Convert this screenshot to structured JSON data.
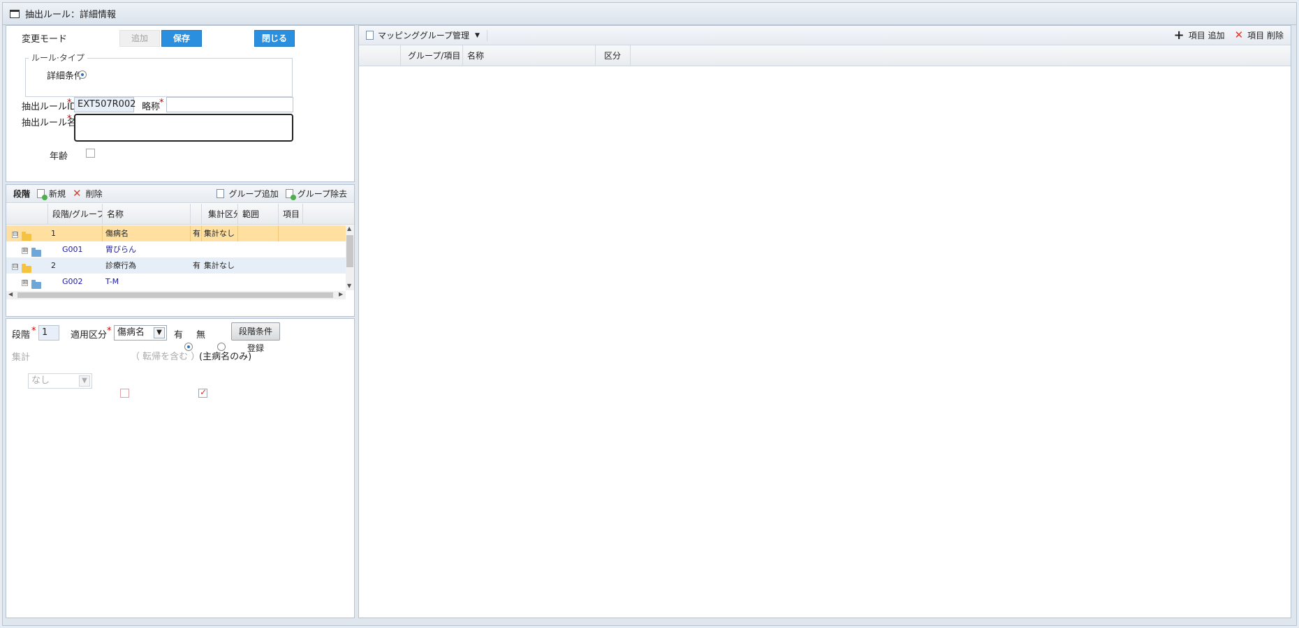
{
  "window": {
    "title": "抽出ルール：詳細情報"
  },
  "form": {
    "mode_label": "変更モード",
    "add_button": "追加",
    "save_button": "保存",
    "close_button": "閉じる",
    "rule_type_legend": "ルール·タイプ",
    "rule_type_option": "詳細条件",
    "rule_id_label": "抽出ルールID",
    "rule_id_value": "EXT507R002",
    "short_name_label": "略称",
    "short_name_value": "",
    "rule_name_label": "抽出ルール名",
    "rule_name_value": "",
    "age_label": "年齢",
    "required_mark": "*"
  },
  "stage_toolbar": {
    "title": "段階",
    "new": "新規",
    "delete": "削除",
    "group_add": "グループ追加",
    "group_remove": "グループ除去"
  },
  "stage_grid": {
    "columns": [
      "段階/グループ",
      "名称",
      "",
      "集計区分",
      "範囲",
      "項目"
    ],
    "rows": [
      {
        "expander": "⊟",
        "id": "1",
        "name": "傷病名",
        "flag": "有",
        "agg": "集計なし",
        "type": "stage",
        "selected": true
      },
      {
        "expander": "⊞",
        "id": "G001",
        "name": "胃びらん",
        "flag": "",
        "agg": "",
        "type": "group"
      },
      {
        "expander": "⊟",
        "id": "2",
        "name": "診療行為",
        "flag": "有",
        "agg": "集計なし",
        "type": "stage",
        "selected": false
      },
      {
        "expander": "⊞",
        "id": "G002",
        "name": "T-M",
        "flag": "",
        "agg": "",
        "type": "group"
      }
    ]
  },
  "stage_form": {
    "stage_label": "段階",
    "stage_value": "1",
    "apply_label": "適用区分",
    "apply_value": "傷病名",
    "yes_label": "有",
    "no_label": "無",
    "register_button": "段階条件登録",
    "agg_label": "集計",
    "agg_value": "なし",
    "include_transfer": "（ 転帰を含む ）",
    "main_only": "(主病名のみ)"
  },
  "mapping": {
    "menu_label": "マッピンググループ管理",
    "item_add": "項目 追加",
    "item_delete": "項目 削除",
    "columns": [
      "グループ/項目",
      "名称",
      "区分"
    ]
  }
}
